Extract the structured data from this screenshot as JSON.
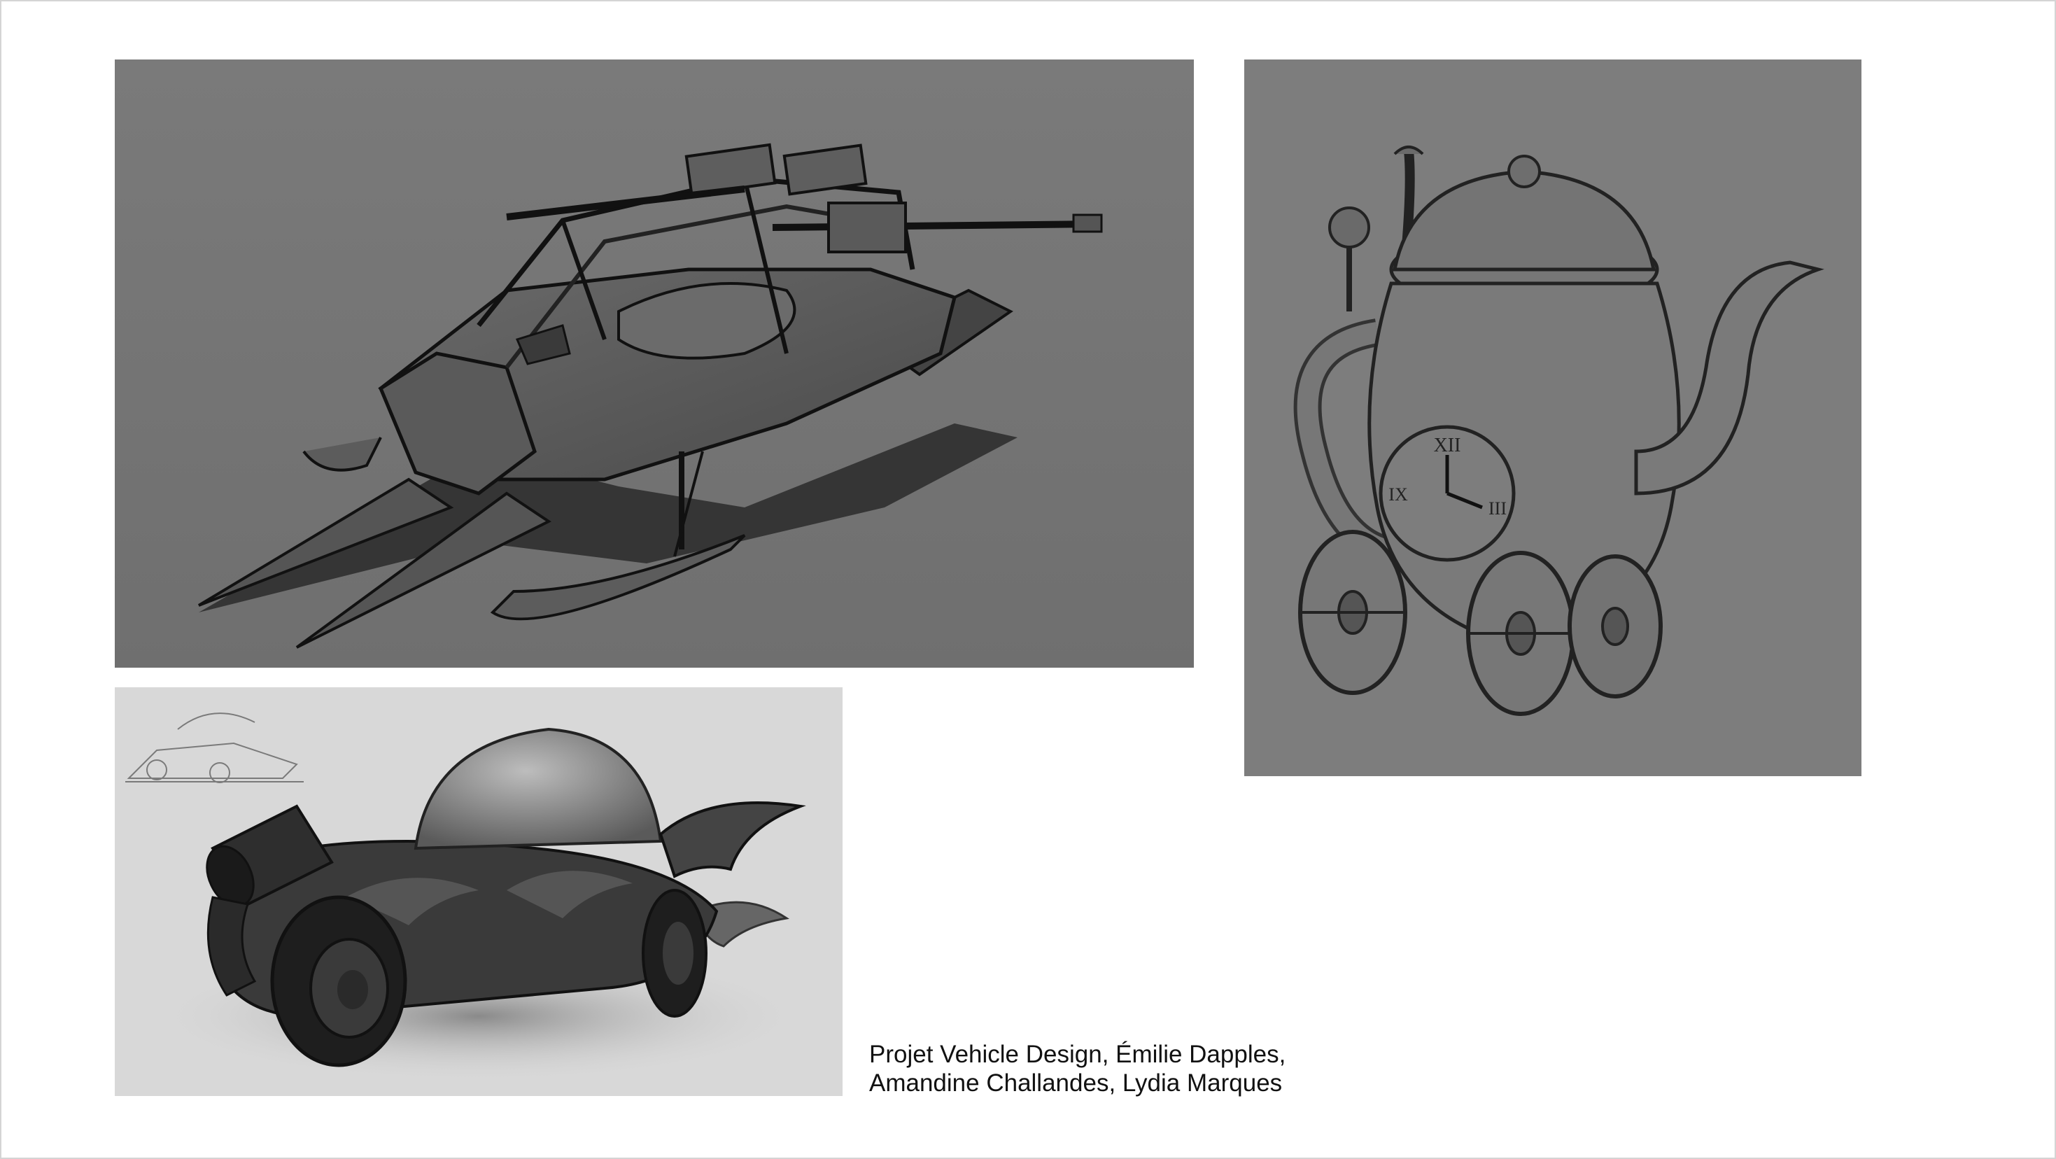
{
  "slide": {
    "caption": {
      "line1": "Projet Vehicle Design, Émilie Dapples,",
      "line2": "Amandine Challandes, Lydia Marques"
    },
    "artworks": [
      {
        "subject": "armed snowmobile sketch"
      },
      {
        "subject": "teapot on wheels with clock face"
      },
      {
        "subject": "dome-top cannon car render"
      }
    ],
    "teapot_clock": {
      "numeral_top": "XII",
      "numeral_left": "IX",
      "numeral_right": "III"
    }
  }
}
